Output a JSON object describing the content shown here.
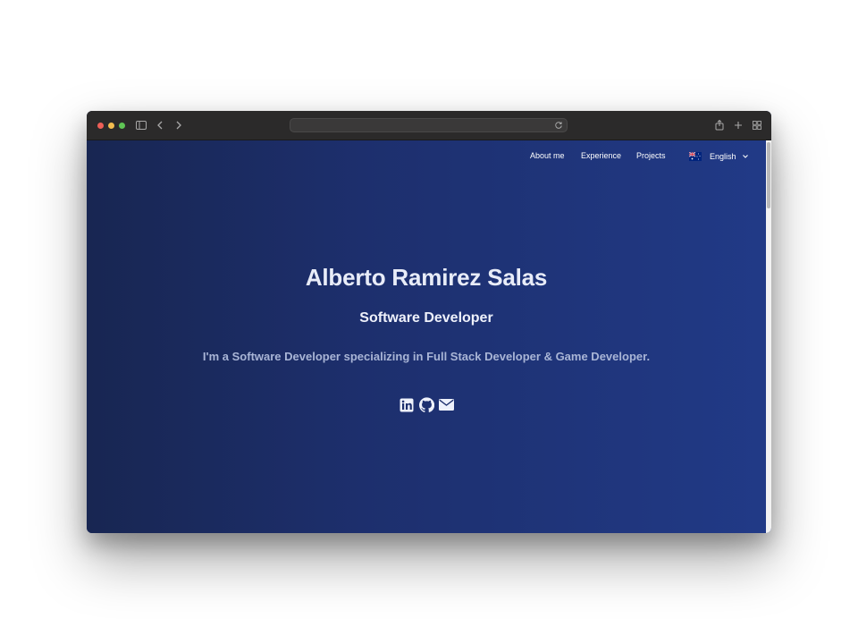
{
  "browser": {
    "url": "",
    "icons": [
      "sidebar-icon",
      "back-icon",
      "forward-icon",
      "reload-icon",
      "share-icon",
      "new-tab-icon",
      "tab-overview-icon"
    ]
  },
  "nav": {
    "links": [
      "About me",
      "Experience",
      "Projects"
    ],
    "language": {
      "label": "English",
      "flag": "australia-flag-icon"
    }
  },
  "hero": {
    "name": "Alberto Ramirez Salas",
    "title": "Software Developer",
    "description": "I'm a Software Developer specializing in Full Stack Developer & Game Developer."
  },
  "socials": [
    "linkedin-icon",
    "github-icon",
    "email-icon"
  ],
  "colors": {
    "background_start": "#182652",
    "background_end": "#213a87",
    "text": "#ffffff",
    "description": "#a9b5d6"
  }
}
